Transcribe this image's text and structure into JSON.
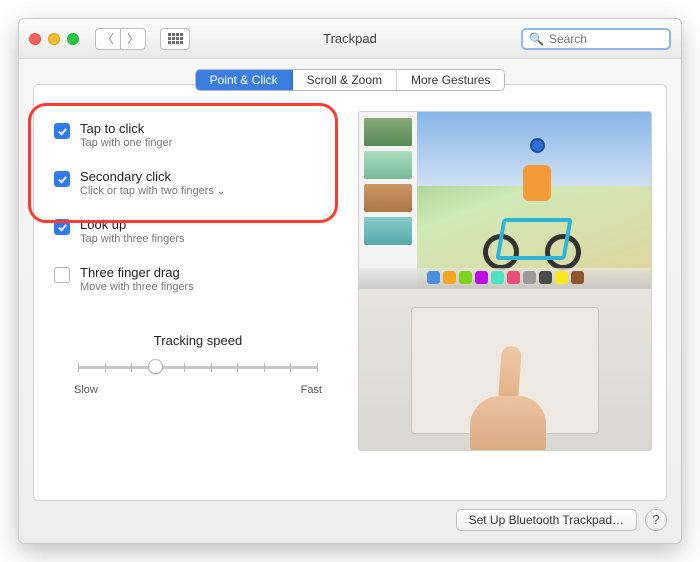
{
  "window": {
    "title": "Trackpad"
  },
  "search": {
    "placeholder": "Search",
    "value": ""
  },
  "tabs": [
    {
      "label": "Point & Click",
      "active": true
    },
    {
      "label": "Scroll & Zoom",
      "active": false
    },
    {
      "label": "More Gestures",
      "active": false
    }
  ],
  "options": [
    {
      "title": "Tap to click",
      "subtitle": "Tap with one finger",
      "checked": true,
      "has_menu": false
    },
    {
      "title": "Secondary click",
      "subtitle": "Click or tap with two fingers",
      "checked": true,
      "has_menu": true
    },
    {
      "title": "Look up",
      "subtitle": "Tap with three fingers",
      "checked": true,
      "has_menu": false
    },
    {
      "title": "Three finger drag",
      "subtitle": "Move with three fingers",
      "checked": false,
      "has_menu": false
    }
  ],
  "tracking": {
    "label": "Tracking speed",
    "min_label": "Slow",
    "max_label": "Fast",
    "ticks": 10,
    "value_index": 3
  },
  "footer": {
    "bluetooth_button": "Set Up Bluetooth Trackpad…"
  },
  "highlight": {
    "present": true,
    "covers_options": [
      0,
      1
    ]
  }
}
